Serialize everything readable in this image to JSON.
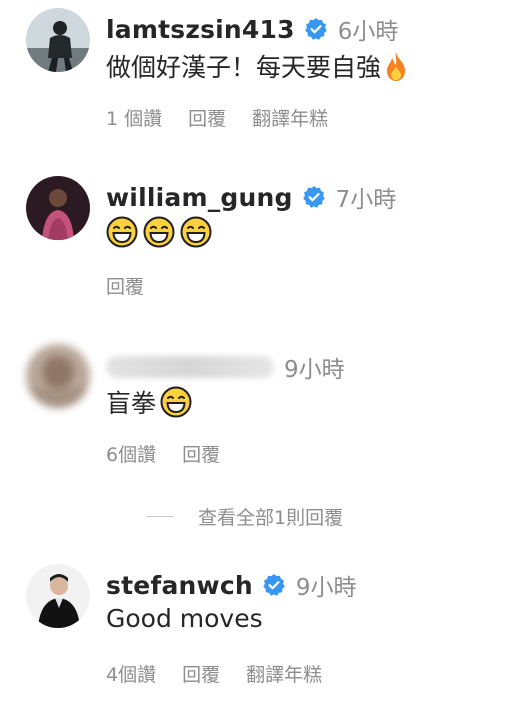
{
  "comments": [
    {
      "username": "lamtszsin413",
      "verified": true,
      "time": "6小時",
      "text": "做個好漢子！每天要自強",
      "emoji_after": "fire-emoji",
      "likes": "1 個讚",
      "reply": "回覆",
      "translate": "翻譯年糕"
    },
    {
      "username": "william_gung",
      "verified": true,
      "time": "7小時",
      "text": "",
      "emojis": [
        "laughing-emoji",
        "laughing-emoji",
        "laughing-emoji"
      ],
      "reply": "回覆"
    },
    {
      "username": "",
      "verified": false,
      "username_blurred": true,
      "time": "9小時",
      "text": "盲拳",
      "emoji_after": "laughing-emoji",
      "likes": "6個讚",
      "reply": "回覆",
      "view_replies": "查看全部1則回覆"
    },
    {
      "username": "stefanwch",
      "verified": true,
      "time": "9小時",
      "text": "Good moves",
      "likes": "4個讚",
      "reply": "回覆",
      "translate": "翻譯年糕"
    }
  ],
  "colors": {
    "verified_badge": "#3897f0",
    "secondary_text": "#8e8e8e",
    "primary_text": "#262626"
  }
}
